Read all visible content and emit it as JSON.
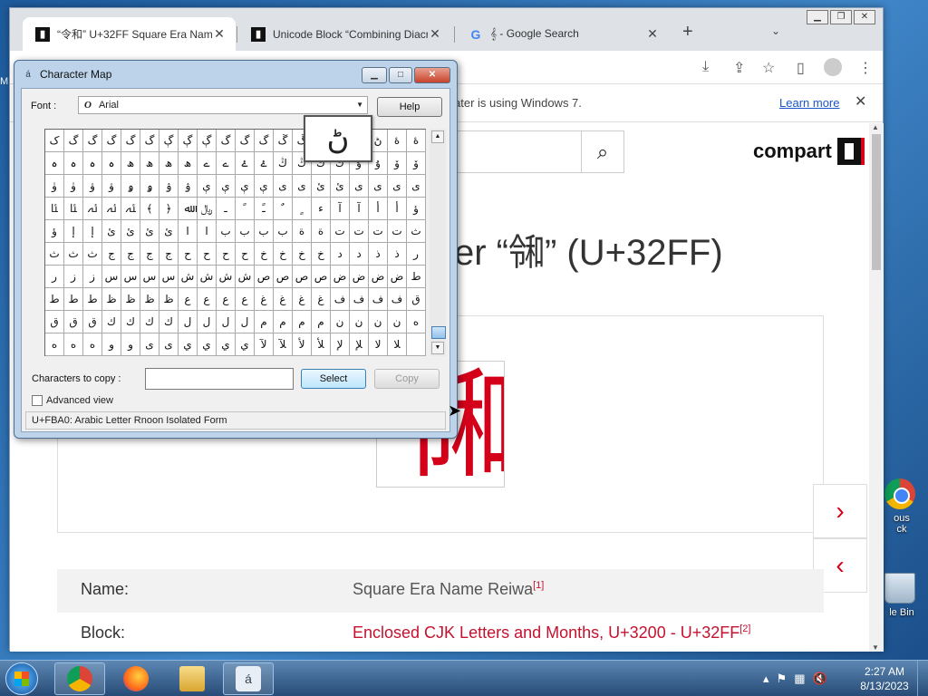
{
  "desktop": {
    "icons": [
      {
        "label": "ous\nck",
        "name": "chrome"
      },
      {
        "label": "le Bin",
        "name": "recycle-bin"
      }
    ],
    "edge_text": "M"
  },
  "browser": {
    "tabs": [
      {
        "title": "“令和” U+32FF Square Era Name Re",
        "favicon": "compart-icon"
      },
      {
        "title": "Unicode Block “Combining Diacr",
        "favicon": "compart-icon"
      },
      {
        "title": "𝄞 - Google Search",
        "favicon": "google-icon"
      }
    ],
    "infobar": {
      "message": "ater is using Windows 7.",
      "link": "Learn more"
    },
    "page": {
      "logo": "compart",
      "heading": "er “㋿” (U+32FF)",
      "glyph": "㋿",
      "rows": [
        {
          "key": "Name:",
          "value": "Square Era Name Reiwa",
          "ref": "[1]"
        },
        {
          "key": "Block:",
          "value": "Enclosed CJK Letters and Months, U+3200 - U+32FF",
          "ref": "[2]"
        }
      ]
    }
  },
  "charmap": {
    "title": "Character Map",
    "font_label": "Font :",
    "font_value": "Arial",
    "help": "Help",
    "zoom_char": "ڻ",
    "grid": [
      "ک",
      "گ",
      "گ",
      "گ",
      "گ",
      "گ",
      "ڳ",
      "ڳ",
      "ڳ",
      "گ",
      "گ",
      "گ",
      "ڱ",
      "ڱ",
      "ڱ",
      "ڱ",
      "ڻ",
      "ڻ",
      "ۀ",
      "ۀ",
      "ہ",
      "ہ",
      "ہ",
      "ہ",
      "ھ",
      "ھ",
      "ھ",
      "ھ",
      "ے",
      "ے",
      "ۓ",
      "ۓ",
      "ڭ",
      "ڭ",
      "ڭ",
      "ڭ",
      "ۇ",
      "ۇ",
      "ۆ",
      "ۆ",
      "ۈ",
      "ۈ",
      "ۋ",
      "ۋ",
      "ۅ",
      "ۅ",
      "ۉ",
      "ۉ",
      "ې",
      "ې",
      "ې",
      "ې",
      "ى",
      "ى",
      "ئ",
      "ئ",
      "ی",
      "ی",
      "ی",
      "ی",
      "ﯫ",
      "ﯫ",
      "ﯬ",
      "ﯬ",
      "ﯭ",
      "﴾",
      "﴿",
      "ﷲ",
      "﷼",
      "ـ",
      "ﹰ",
      "ﹱ",
      "ﹲ",
      "ﹴ",
      "ء",
      "آ",
      "آ",
      "أ",
      "أ",
      "ؤ",
      "ؤ",
      "إ",
      "إ",
      "ئ",
      "ئ",
      "ئ",
      "ئ",
      "ا",
      "ا",
      "ب",
      "ب",
      "ب",
      "ب",
      "ة",
      "ة",
      "ت",
      "ت",
      "ت",
      "ت",
      "ث",
      "ث",
      "ث",
      "ث",
      "ج",
      "ج",
      "ج",
      "ج",
      "ح",
      "ح",
      "ح",
      "ح",
      "خ",
      "خ",
      "خ",
      "خ",
      "د",
      "د",
      "ذ",
      "ذ",
      "ر",
      "ر",
      "ز",
      "ز",
      "س",
      "س",
      "س",
      "س",
      "ش",
      "ش",
      "ش",
      "ش",
      "ص",
      "ص",
      "ص",
      "ص",
      "ض",
      "ض",
      "ض",
      "ض",
      "ط",
      "ط",
      "ط",
      "ط",
      "ظ",
      "ظ",
      "ظ",
      "ظ",
      "ع",
      "ع",
      "ع",
      "ع",
      "غ",
      "غ",
      "غ",
      "غ",
      "ف",
      "ف",
      "ف",
      "ف",
      "ق",
      "ق",
      "ق",
      "ق",
      "ك",
      "ك",
      "ك",
      "ك",
      "ل",
      "ل",
      "ل",
      "ل",
      "م",
      "م",
      "م",
      "م",
      "ن",
      "ن",
      "ن",
      "ن",
      "ه",
      "ه",
      "ه",
      "ه",
      "و",
      "و",
      "ى",
      "ى",
      "ي",
      "ي",
      "ي",
      "ي",
      "ﻵ",
      "ﻶ",
      "ﻷ",
      "ﻸ",
      "ﻹ",
      "ﻺ",
      "ﻻ",
      "ﻼ",
      "",
      ""
    ],
    "copy_label": "Characters to copy :",
    "copy_value": "",
    "select": "Select",
    "copy": "Copy",
    "advanced": "Advanced view",
    "status": "U+FBA0: Arabic Letter Rnoon Isolated Form"
  },
  "taskbar": {
    "apps": [
      "Chrome",
      "Firefox",
      "Explorer",
      "Character Map"
    ],
    "time": "2:27 AM",
    "date": "8/13/2023"
  }
}
